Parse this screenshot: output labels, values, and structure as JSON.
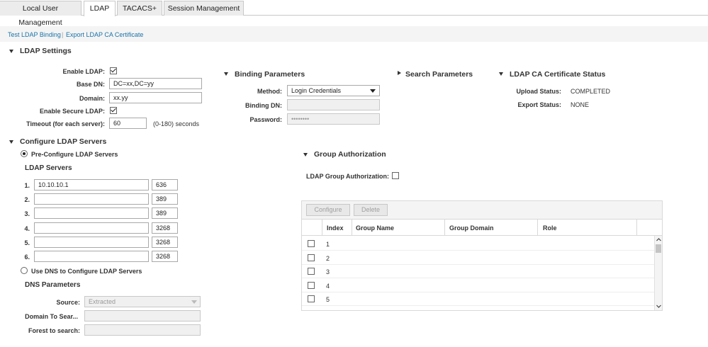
{
  "tabs": [
    {
      "label": "Local User Management",
      "active": false
    },
    {
      "label": "LDAP",
      "active": true
    },
    {
      "label": "TACACS+",
      "active": false
    },
    {
      "label": "Session Management",
      "active": false
    }
  ],
  "links": {
    "test_binding": "Test LDAP Binding",
    "separator": "|",
    "export_ca": "Export LDAP CA Certificate"
  },
  "ldap_settings": {
    "title": "LDAP Settings",
    "enable_ldap_label": "Enable LDAP:",
    "enable_ldap": true,
    "base_dn_label": "Base DN:",
    "base_dn_value": "DC=xx,DC=yy",
    "domain_label": "Domain:",
    "domain_value": "xx.yy",
    "secure_label": "Enable Secure LDAP:",
    "secure": true,
    "timeout_label": "Timeout (for each server):",
    "timeout_value": "60",
    "timeout_hint": "(0-180) seconds"
  },
  "binding": {
    "title": "Binding Parameters",
    "method_label": "Method:",
    "method_value": "Login Credentials",
    "binding_dn_label": "Binding DN:",
    "binding_dn_value": "",
    "password_label": "Password:",
    "password_value": "••••••••"
  },
  "search": {
    "title": "Search Parameters"
  },
  "ca_status": {
    "title": "LDAP CA Certificate Status",
    "upload_label": "Upload Status:",
    "upload_value": "COMPLETED",
    "export_label": "Export Status:",
    "export_value": "NONE"
  },
  "servers": {
    "title": "Configure LDAP Servers",
    "preconfig_label": "Pre-Configure LDAP Servers",
    "preconfig_selected": true,
    "list_title": "LDAP Servers",
    "rows": [
      {
        "num": "1.",
        "host": "10.10.10.1",
        "port": "636"
      },
      {
        "num": "2.",
        "host": "",
        "port": "389"
      },
      {
        "num": "3.",
        "host": "",
        "port": "389"
      },
      {
        "num": "4.",
        "host": "",
        "port": "3268"
      },
      {
        "num": "5.",
        "host": "",
        "port": "3268"
      },
      {
        "num": "6.",
        "host": "",
        "port": "3268"
      }
    ],
    "dns_label": "Use DNS to Configure LDAP Servers",
    "dns_selected": false
  },
  "dns": {
    "title": "DNS Parameters",
    "source_label": "Source:",
    "source_value": "Extracted",
    "domain_label": "Domain To Sear...",
    "domain_value": "",
    "forest_label": "Forest to search:",
    "forest_value": ""
  },
  "group_auth": {
    "title": "Group Authorization",
    "ldap_group_label": "LDAP Group Authorization:",
    "ldap_group_enabled": false,
    "configure_label": "Configure",
    "delete_label": "Delete",
    "columns": [
      "Index",
      "Group Name",
      "Group Domain",
      "Role"
    ],
    "rows": [
      {
        "index": "1"
      },
      {
        "index": "2"
      },
      {
        "index": "3"
      },
      {
        "index": "4"
      },
      {
        "index": "5"
      }
    ]
  },
  "colors": {
    "link": "#1a73a8",
    "tab_bg": "#ececec",
    "disabled_bg": "#f0f0f0"
  }
}
